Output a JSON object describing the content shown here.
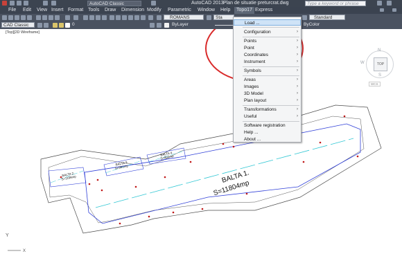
{
  "titlebar": {
    "workspace": "AutoCAD Classic",
    "app_title": "AutoCAD 2013",
    "file_name": "Plan de situatie preturcrat.dwg",
    "search_placeholder": "Type a keyword or phrase"
  },
  "menubar": {
    "items": [
      "File",
      "Edit",
      "View",
      "Insert",
      "Format",
      "Tools",
      "Draw",
      "Dimension",
      "Modify",
      "Parametric",
      "Window",
      "Help",
      "Topo17",
      "Express"
    ]
  },
  "toolbar": {
    "text_style": "ROMANS",
    "dim_style_partial": "Sta",
    "right_style": "Standard",
    "workspace": "CAD Classic",
    "layer": "0",
    "linetype": "ByLayer",
    "color": "ByColor"
  },
  "viewport": {
    "label": "[Top][2D Wireframe]"
  },
  "viewcube": {
    "top": "TOP",
    "west": "W",
    "north": "N",
    "south": "S",
    "wcs": "WCS"
  },
  "topo_menu": {
    "items": [
      {
        "label": "Load ...",
        "submenu": false
      },
      {
        "label": "Configuration",
        "submenu": true
      },
      {
        "label": "Points",
        "submenu": true
      },
      {
        "label": "Point",
        "submenu": true
      },
      {
        "label": "Coordinates",
        "submenu": true
      },
      {
        "label": "Instrument",
        "submenu": true
      },
      {
        "label": "Symbols",
        "submenu": true
      },
      {
        "label": "Areas",
        "submenu": true
      },
      {
        "label": "Images",
        "submenu": true
      },
      {
        "label": "3D Model",
        "submenu": true
      },
      {
        "label": "Plan layout",
        "submenu": true
      },
      {
        "label": "Transformations",
        "submenu": true
      },
      {
        "label": "Useful",
        "submenu": true
      },
      {
        "label": "Software registration",
        "submenu": false
      },
      {
        "label": "Help ...",
        "submenu": false
      },
      {
        "label": "About ...",
        "submenu": false
      }
    ]
  },
  "drawing": {
    "balta1_name": "BALTA 1.",
    "balta1_area": "S=11804mp",
    "balta2_name": "BALTA 2.",
    "balta2_area": "S=1196mp",
    "balta3_name": "BALTA 3.",
    "balta3_area": "S=961mp",
    "balta4_name": "BALTA 4.",
    "balta4_area": "S=802mp"
  },
  "ucs": {
    "y_label": "Y",
    "x_label": "X"
  },
  "colors": {
    "highlight_circle": "#d92b2b",
    "pond_outline": "#2f3fd8",
    "dashed_line": "#31c7d4"
  }
}
